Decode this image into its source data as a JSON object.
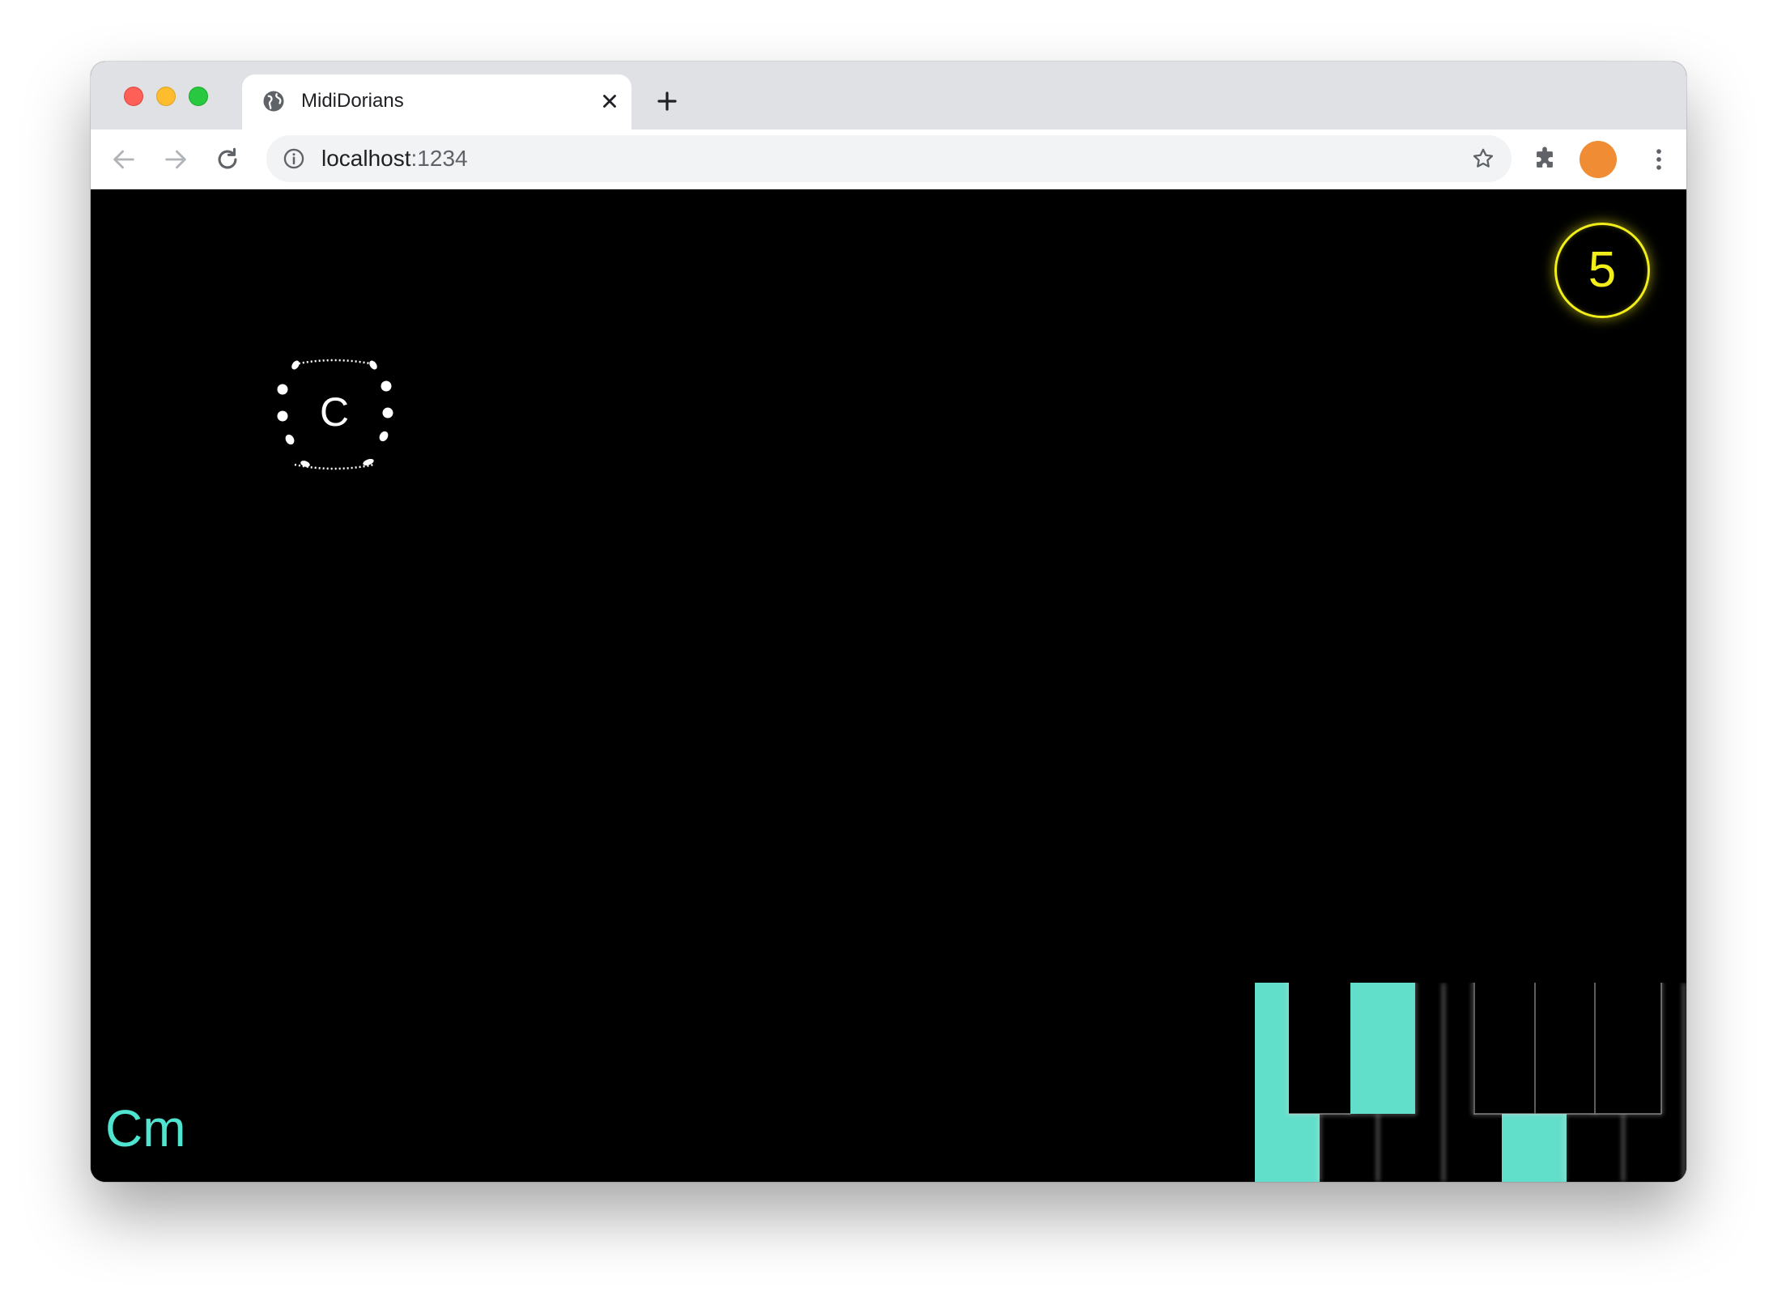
{
  "browser": {
    "tab_title": "MidiDorians",
    "url_host": "localhost",
    "url_port": ":1234",
    "icons": [
      "globe-icon",
      "close-icon",
      "plus-icon",
      "back-arrow-icon",
      "forward-arrow-icon",
      "reload-icon",
      "info-icon",
      "star-icon",
      "puzzle-icon",
      "kebab-menu-icon"
    ],
    "avatar_color": "#f08c33"
  },
  "app": {
    "counter": "5",
    "counter_color": "#f2ee1a",
    "note": "C",
    "chord": "Cm",
    "accent_color": "#62dfcb",
    "keyboard": {
      "white_keys_pressed": [
        0,
        4
      ],
      "black_keys_pressed": [
        1
      ]
    }
  }
}
